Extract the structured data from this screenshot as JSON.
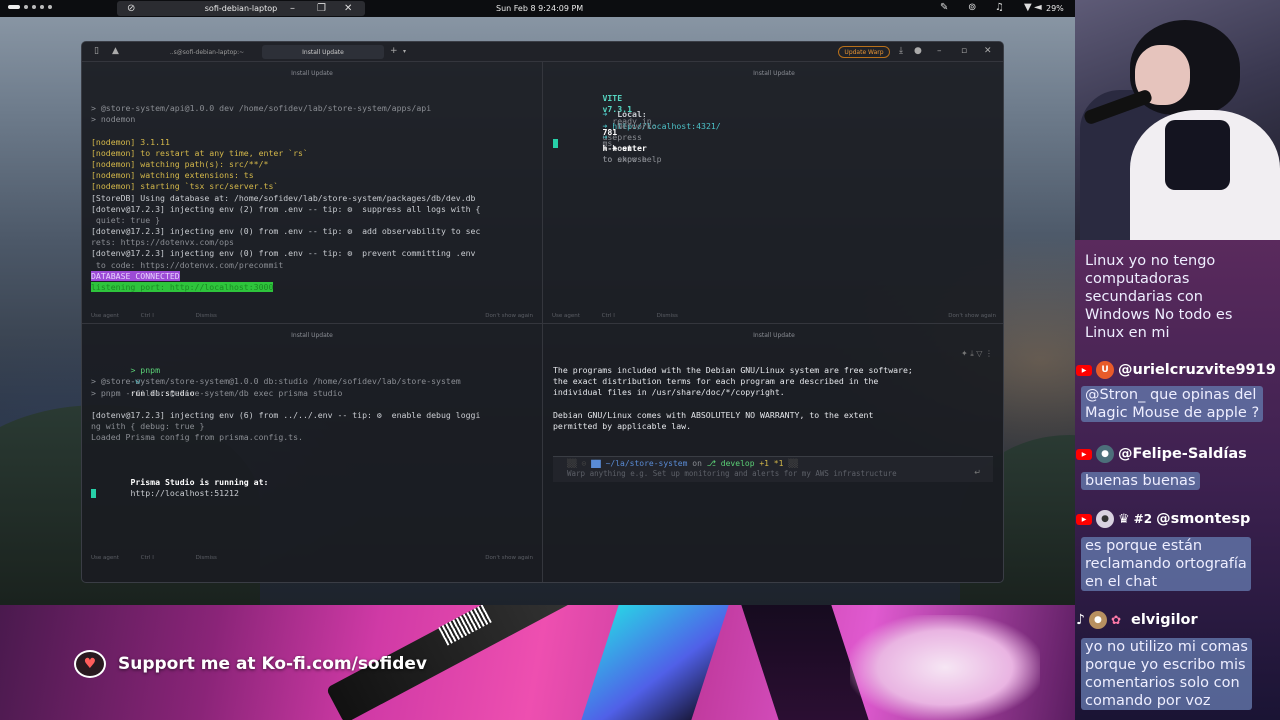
{
  "topbar": {
    "window_title": "sofi-debian-laptop",
    "clock": "Sun Feb 8   9:24:09 PM",
    "battery": "29%"
  },
  "warp": {
    "tab_inactive": "..s@sofi-debian-laptop:~",
    "tab_active": "Install Update",
    "update_button": "Update Warp",
    "pane_header": "Install Update",
    "footer": {
      "agent": "Use agent",
      "agent_key": "Ctrl  I",
      "dismiss": "Dismiss",
      "dont_show": "Don't show again"
    }
  },
  "pane_api": {
    "lines": [
      "> @store-system/api@1.0.0 dev /home/sofidev/lab/store-system/apps/api",
      "> nodemon",
      "",
      "[nodemon] 3.1.11",
      "[nodemon] to restart at any time, enter `rs`",
      "[nodemon] watching path(s): src/**/*",
      "[nodemon] watching extensions: ts",
      "[nodemon] starting `tsx src/server.ts`",
      "[StoreDB] Using database at: /home/sofidev/lab/store-system/packages/db/dev.db",
      "[dotenv@17.2.3] injecting env (2) from .env -- tip: ⚙  suppress all logs with {",
      " quiet: true }",
      "[dotenv@17.2.3] injecting env (0) from .env -- tip: ⚙  add observability to sec",
      "rets: https://dotenvx.com/ops",
      "[dotenv@17.2.3] injecting env (0) from .env -- tip: ⚙  prevent committing .env",
      " to code: https://dotenvx.com/precommit"
    ],
    "db_connected": "DATABASE CONNECTED",
    "listening": "listening port: http://localhost:3000"
  },
  "pane_vite": {
    "vite_name": "VITE",
    "vite_version": "v7.3.1",
    "ready_text": "ready in",
    "ready_ms": "781",
    "ready_unit": "ms",
    "local_label": "Local:",
    "local_url": "http://localhost:4321/",
    "network_label": "Network:",
    "network_text": "use",
    "network_flag": "--host",
    "network_rest": "to expose",
    "help_press": "press",
    "help_key": "h + enter",
    "help_rest": "to show help"
  },
  "pane_studio": {
    "command_prefix": "> pnpm",
    "command_flag": "-w",
    "command_rest": "run db:studio",
    "lines": [
      "> @store-system/store-system@1.0.0 db:studio /home/sofidev/lab/store-system",
      "> pnpm --filter @store-system/db exec prisma studio",
      "",
      "[dotenv@17.2.3] injecting env (6) from ../../.env -- tip: ⚙  enable debug loggi",
      "ng with { debug: true }",
      "Loaded Prisma config from prisma.config.ts.",
      "",
      ""
    ],
    "studio_label": "Prisma Studio is running at:",
    "studio_url": "http://localhost:51212"
  },
  "pane_shell": {
    "motd": [
      "The programs included with the Debian GNU/Linux system are free software;",
      "the exact distribution terms for each program are described in the",
      "individual files in /usr/share/doc/*/copyright.",
      "",
      "Debian GNU/Linux comes with ABSOLUTELY NO WARRANTY, to the extent",
      "permitted by applicable law."
    ],
    "prompt_path": "~/la/store-system",
    "prompt_on": "on",
    "prompt_branch": "develop",
    "prompt_changes": "+1  *1",
    "input_placeholder": "Warp anything e.g. Set up monitoring and alerts for my AWS infrastructure"
  },
  "kofi": {
    "text": "Support me at Ko-fi.com/sofidev"
  },
  "chat": {
    "messages": [
      {
        "id": "m0",
        "user": "",
        "text_lines": [
          "Linux yo no tengo",
          "computadoras",
          "secundarias con",
          "Windows No todo es",
          "Linux en mi"
        ]
      },
      {
        "id": "m1",
        "user": "@urielcruzvite9919",
        "avatar_letter": "U",
        "text_lines": [
          "@Stron_ que opinas del",
          "Magic Mouse de apple ?"
        ]
      },
      {
        "id": "m2",
        "user": "@Felipe-Saldías",
        "text_lines": [
          "buenas buenas"
        ]
      },
      {
        "id": "m3",
        "user": "@smontesp",
        "badge": "#2",
        "text_lines": [
          "es porque están",
          "reclamando ortografía",
          "en el chat"
        ]
      },
      {
        "id": "m4",
        "user": "elvigilor",
        "text_lines": [
          "yo no utilizo mi comas",
          "porque yo escribo mis",
          "comentarios solo con",
          "comando por voz"
        ]
      }
    ]
  },
  "colors": {
    "chat_bubble": "#6275a8",
    "youtube_red": "#ff0000",
    "vite_accent": "#56d7c2",
    "db_connected_bg": "#9c4bd6",
    "listening_bg": "#2ec43c",
    "update_warp": "#e89433"
  }
}
